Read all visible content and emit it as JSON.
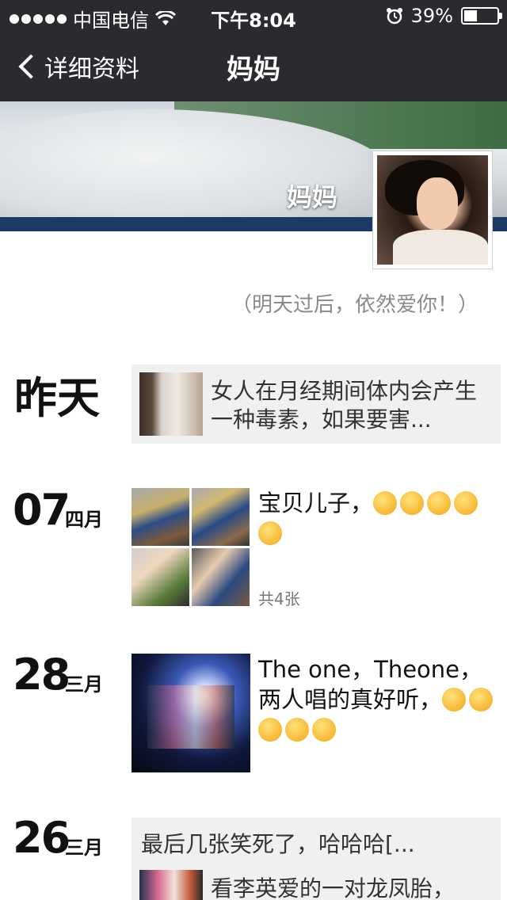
{
  "status_bar": {
    "carrier": "中国电信",
    "time": "下午8:04",
    "battery_text": "39%",
    "battery_level": 0.39,
    "icons": [
      "signal-icon",
      "wifi-icon",
      "alarm-icon",
      "battery-icon"
    ]
  },
  "nav": {
    "back_label": "详细资料",
    "title": "妈妈"
  },
  "profile": {
    "cover_name": "妈妈",
    "signature": "（明天过后，依然爱你！）"
  },
  "timeline": [
    {
      "date_word": "昨天",
      "text": "女人在月经期间体内会产生一种毒素，如果要害..."
    },
    {
      "day": "07",
      "month": "四月",
      "text": "宝贝儿子，",
      "emoji_count": 5,
      "photo_count": "共4张"
    },
    {
      "day": "28",
      "month": "三月",
      "text": "The one，Theone，两人唱的真好听，",
      "emoji_count": 5
    },
    {
      "day": "26",
      "month": "三月",
      "text": "最后几张笑死了，哈哈哈[...",
      "subtext": "看李英爱的一对龙凤胎，"
    }
  ]
}
